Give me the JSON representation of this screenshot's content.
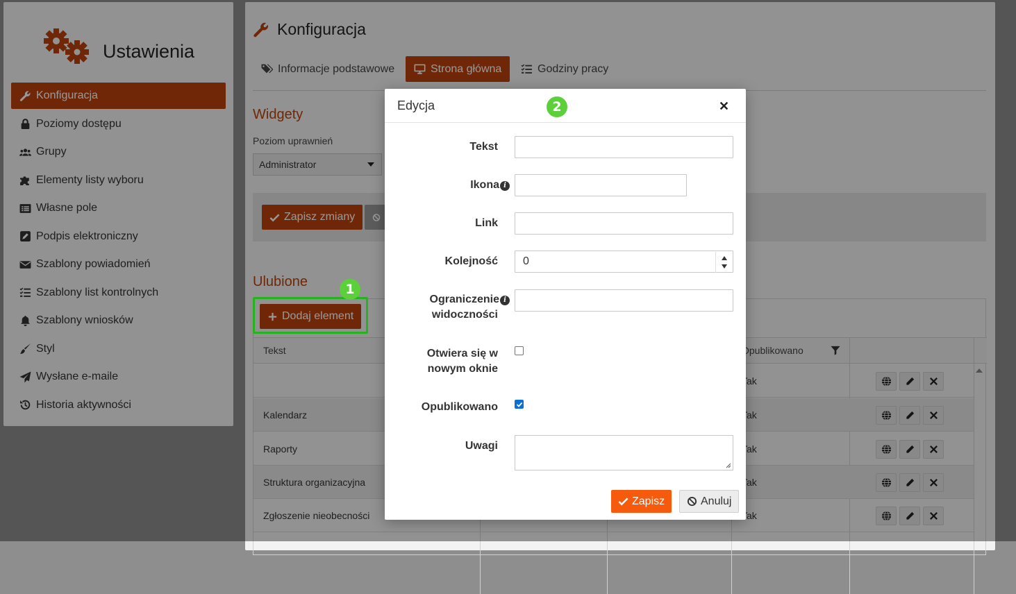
{
  "sidebar": {
    "title": "Ustawienia",
    "items": [
      {
        "label": "Konfiguracja",
        "icon": "wrench-icon",
        "active": true
      },
      {
        "label": "Poziomy dostępu",
        "icon": "lock-icon"
      },
      {
        "label": "Grupy",
        "icon": "users-icon"
      },
      {
        "label": "Elementy listy wyboru",
        "icon": "puzzle-icon"
      },
      {
        "label": "Własne pole",
        "icon": "list-alt-icon"
      },
      {
        "label": "Podpis elektroniczny",
        "icon": "signature-icon"
      },
      {
        "label": "Szablony powiadomień",
        "icon": "envelope-icon"
      },
      {
        "label": "Szablony list kontrolnych",
        "icon": "checklist-icon"
      },
      {
        "label": "Szablony wniosków",
        "icon": "bell-icon"
      },
      {
        "label": "Styl",
        "icon": "brush-icon"
      },
      {
        "label": "Wysłane e-maile",
        "icon": "paper-plane-icon"
      },
      {
        "label": "Historia aktywności",
        "icon": "history-icon"
      }
    ]
  },
  "main": {
    "title": "Konfiguracja",
    "tabs": [
      {
        "label": "Informacje podstawowe",
        "icon": "tags-icon"
      },
      {
        "label": "Strona główna",
        "icon": "desktop-icon",
        "active": true
      },
      {
        "label": "Godziny pracy",
        "icon": "tasks-icon"
      }
    ],
    "widgets_title": "Widgety",
    "permission_label": "Poziom uprawnień",
    "permission_value": "Administrator",
    "save_changes_label": "Zapisz zmiany",
    "favorites_title": "Ulubione",
    "add_element_label": "Dodaj element",
    "grid": {
      "col_text": "Tekst",
      "col_published": "Opublikowano",
      "rows": [
        {
          "text": "",
          "published": "Tak"
        },
        {
          "text": "Kalendarz",
          "published": "Tak"
        },
        {
          "text": "Raporty",
          "published": "Tak"
        },
        {
          "text": "Struktura organizacyjna",
          "published": "Tak"
        },
        {
          "text": "Zgłoszenie nieobecności",
          "published": "Tak"
        }
      ]
    }
  },
  "annotations": {
    "badge1": "1",
    "badge2": "2",
    "highlight_color": "#27b320"
  },
  "modal": {
    "title": "Edycja",
    "close_icon": "close-icon",
    "fields": {
      "tekst": {
        "label": "Tekst",
        "value": ""
      },
      "ikona": {
        "label": "Ikona",
        "value": ""
      },
      "link": {
        "label": "Link",
        "value": ""
      },
      "kolejnosc": {
        "label": "Kolejność",
        "value": "0"
      },
      "ograniczenie": {
        "label_line1": "Ograniczenie",
        "label_line2": "widoczności",
        "value": ""
      },
      "nowe_okno": {
        "label_line1": "Otwiera się w",
        "label_line2": "nowym oknie",
        "checked": false
      },
      "opublikowano": {
        "label": "Opublikowano",
        "checked": true
      },
      "uwagi": {
        "label": "Uwagi",
        "value": ""
      }
    },
    "save_label": "Zapisz",
    "cancel_label": "Anuluj"
  },
  "colors": {
    "accent": "#b9410d",
    "modal_save": "#f55a0d",
    "checkbox": "#0b6fd4"
  }
}
